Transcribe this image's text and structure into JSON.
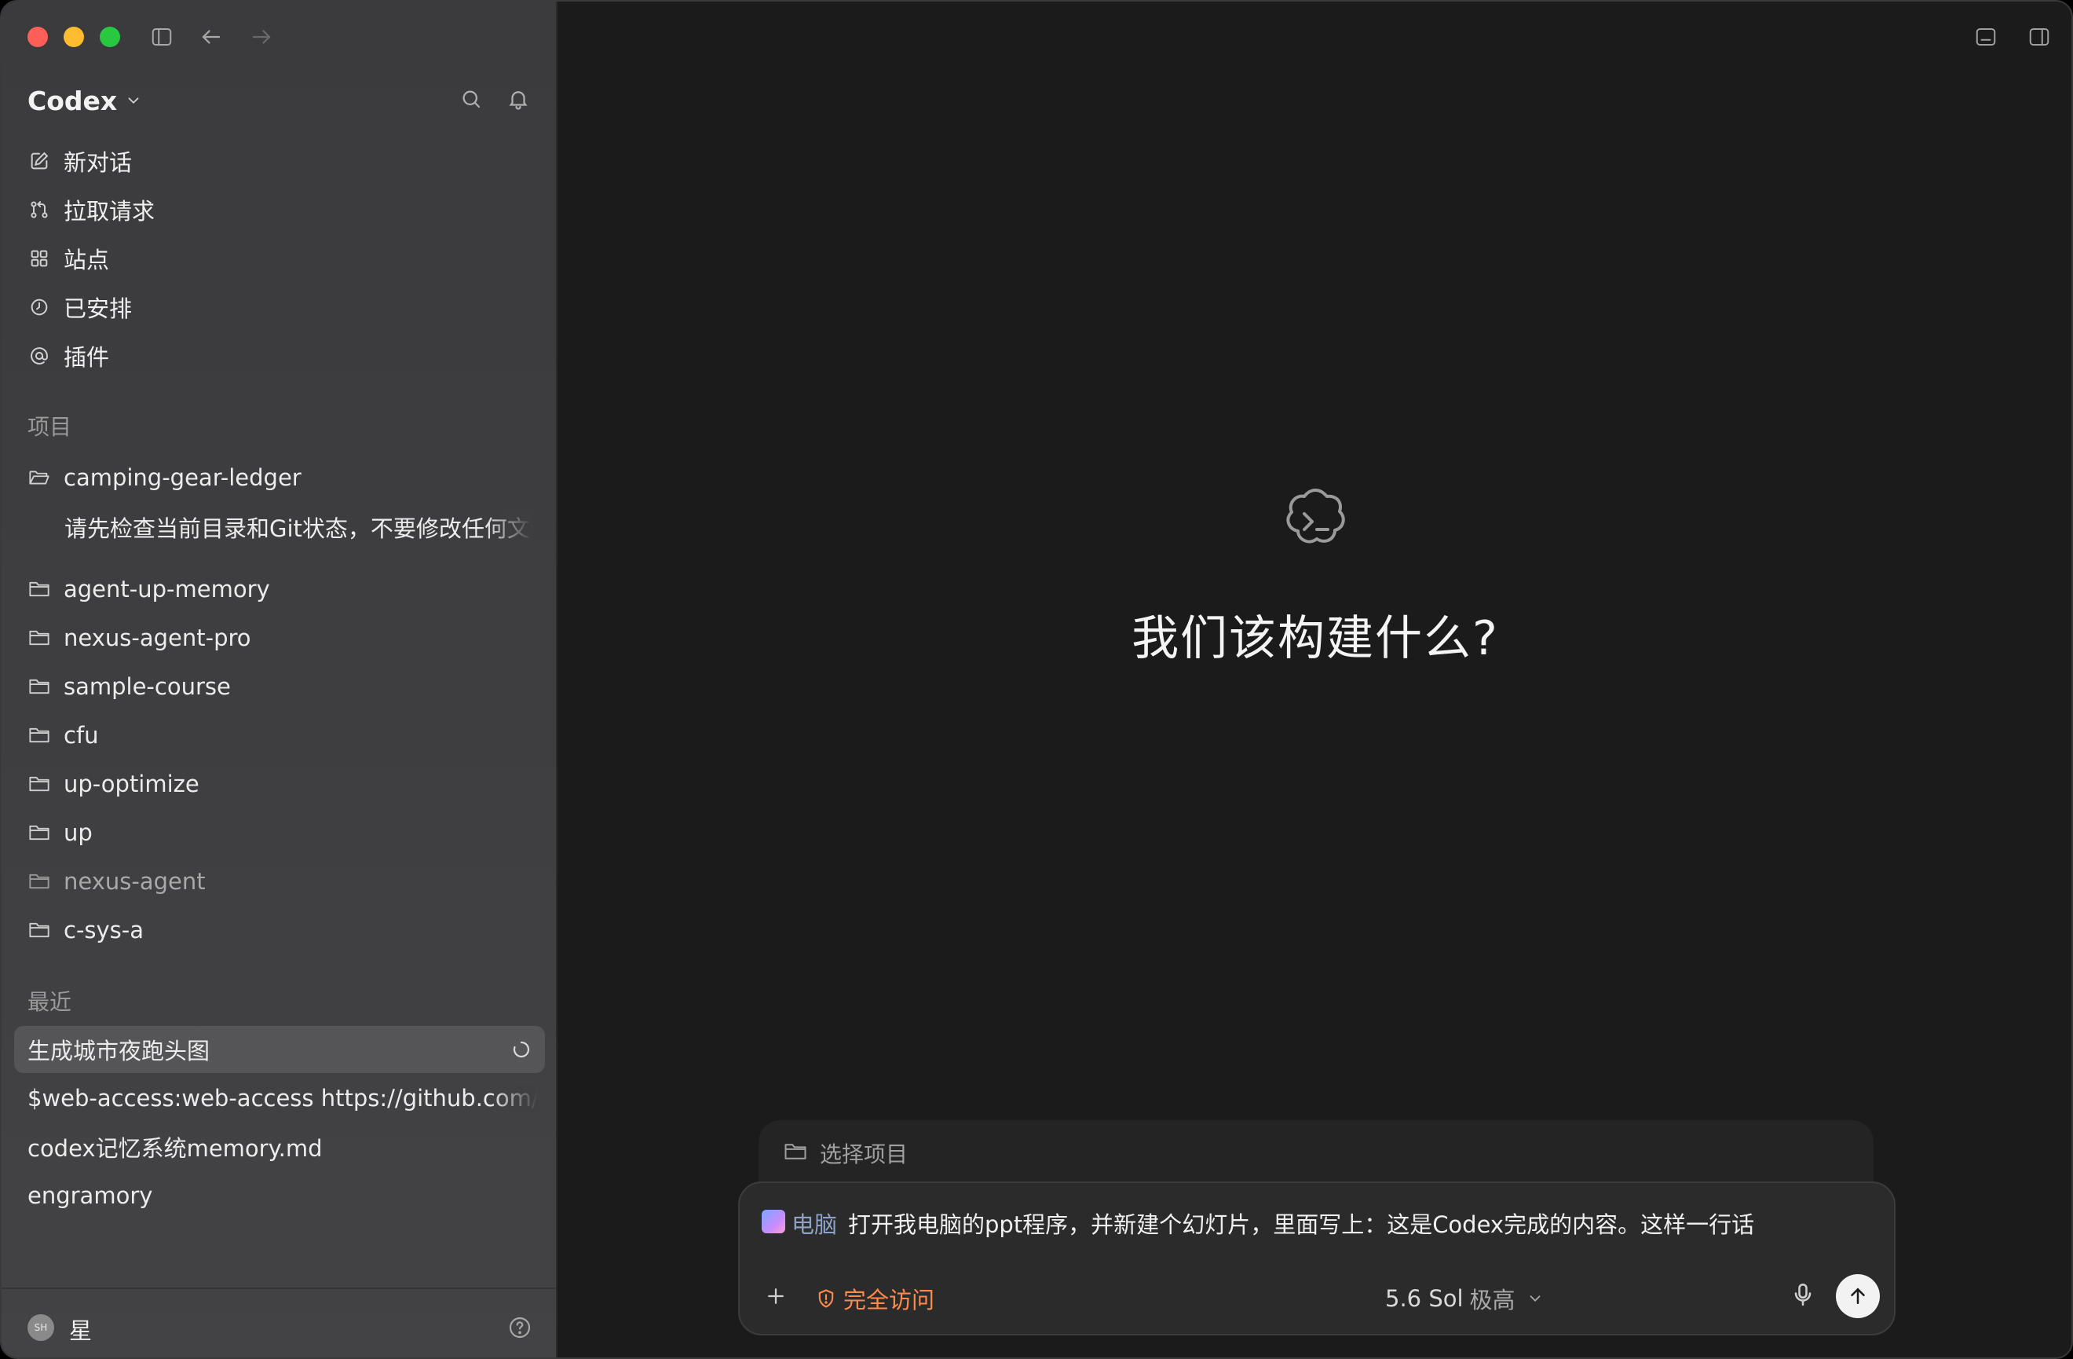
{
  "app": {
    "title": "Codex"
  },
  "nav": {
    "items": [
      {
        "label": "新对话",
        "icon": "edit-icon"
      },
      {
        "label": "拉取请求",
        "icon": "pull-request-icon"
      },
      {
        "label": "站点",
        "icon": "grid-icon"
      },
      {
        "label": "已安排",
        "icon": "clock-icon"
      },
      {
        "label": "插件",
        "icon": "at-icon"
      }
    ]
  },
  "projects": {
    "header": "项目",
    "items": [
      {
        "label": "camping-gear-ledger"
      },
      {
        "label": "agent-up-memory"
      },
      {
        "label": "nexus-agent-pro"
      },
      {
        "label": "sample-course"
      },
      {
        "label": "cfu"
      },
      {
        "label": "up-optimize"
      },
      {
        "label": "up"
      },
      {
        "label": "nexus-agent"
      },
      {
        "label": "c-sys-a"
      }
    ],
    "sub_thread": "请先检查当前目录和Git状态，不要修改任何文件"
  },
  "recent": {
    "header": "最近",
    "items": [
      {
        "label": "生成城市夜跑头图",
        "active": true
      },
      {
        "label": "$web-access:web-access https://github.com/l"
      },
      {
        "label": "codex记忆系统memory.md"
      },
      {
        "label": "engramory"
      }
    ]
  },
  "user": {
    "initials": "SH",
    "name": "星"
  },
  "main": {
    "hero_title": "我们该构建什么?",
    "project_picker": "选择项目",
    "composer": {
      "chip_label": "电脑",
      "prompt": "打开我电脑的ppt程序，并新建个幻灯片，里面写上：这是Codex完成的内容。这样一行话",
      "access_label": "完全访问",
      "model_name": "5.6 Sol",
      "model_level": "极高"
    }
  },
  "colors": {
    "accent_orange": "#ff8a4a",
    "sidebar_bg": "#3e3e40",
    "main_bg": "#1b1b1b"
  }
}
